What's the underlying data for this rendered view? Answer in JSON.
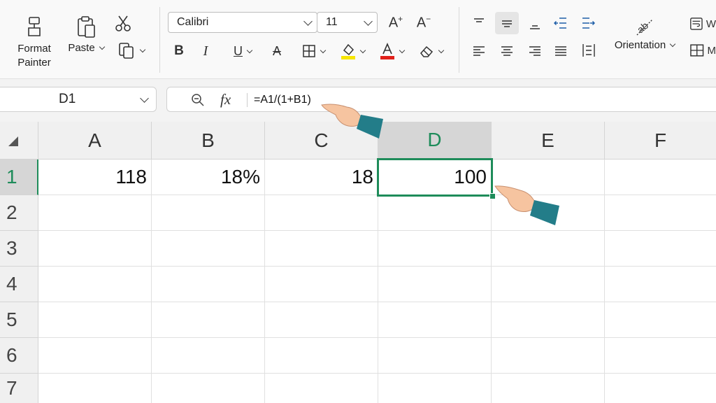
{
  "ribbon": {
    "format_painter_label_1": "Format",
    "format_painter_label_2": "Painter",
    "paste_label": "Paste",
    "font_name": "Calibri",
    "font_size": "11",
    "orientation_label": "Orientation",
    "wrap_fragment": "W",
    "merge_fragment": "M"
  },
  "formula_bar": {
    "name_box": "D1",
    "formula": "=A1/(1+B1)"
  },
  "grid": {
    "columns": [
      "A",
      "B",
      "C",
      "D",
      "E",
      "F"
    ],
    "rows": [
      "1",
      "2",
      "3",
      "4",
      "5",
      "6",
      "7"
    ],
    "row1": {
      "A": "118",
      "B": "18%",
      "C": "18",
      "D": "100"
    }
  },
  "colors": {
    "selection": "#1e8c5a",
    "header_bg": "#f0f0f0",
    "selected_header_bg": "#d6d6d6",
    "font_highlight": "#f7e600",
    "font_color": "#e0201a",
    "pointer_sleeve": "#237d89",
    "pointer_skin": "#f6c4a0"
  }
}
